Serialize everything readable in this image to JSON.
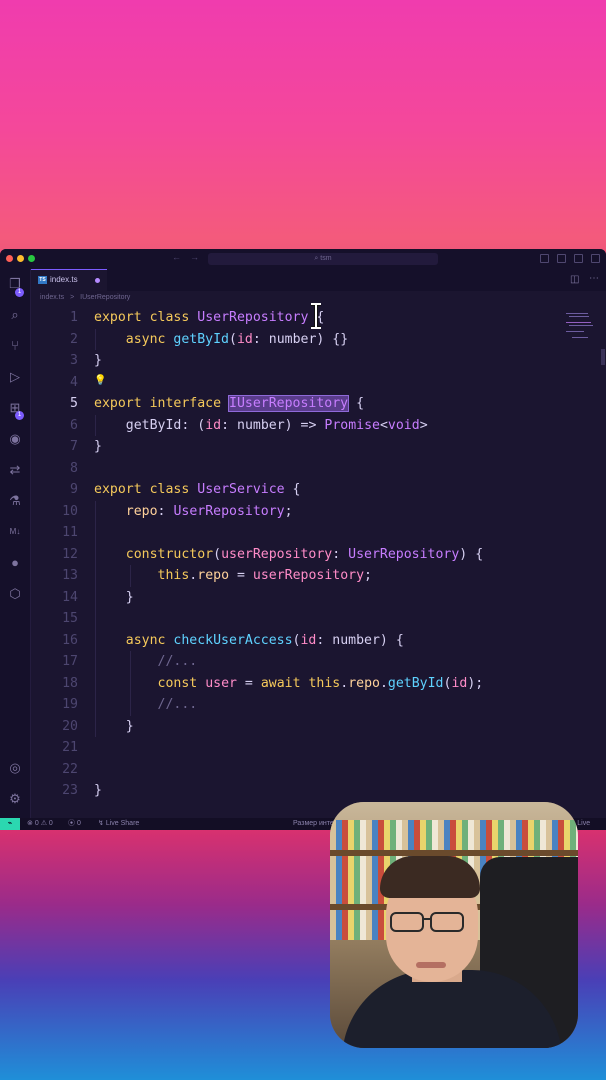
{
  "window": {
    "search_placeholder": "tsm",
    "tab": {
      "name": "index.ts",
      "icon": "typescript-icon"
    },
    "breadcrumb": {
      "file": "index.ts",
      "separator": ">",
      "symbol": "IUserRepository"
    }
  },
  "editor": {
    "active_line": 5,
    "line_numbers": [
      "1",
      "2",
      "3",
      "4",
      "5",
      "6",
      "7",
      "8",
      "9",
      "10",
      "11",
      "12",
      "13",
      "14",
      "15",
      "16",
      "17",
      "18",
      "19",
      "20",
      "21",
      "22",
      "23"
    ],
    "lines": [
      "export class UserRepository {",
      "    async getById(id: number) {}",
      "}",
      "",
      "export interface IUserRepository {",
      "    getById: (id: number) => Promise<void>",
      "}",
      "",
      "export class UserService {",
      "    repo: UserRepository;",
      "",
      "    constructor(userRepository: UserRepository) {",
      "        this.repo = userRepository;",
      "    }",
      "",
      "    async checkUserAccess(id: number) {",
      "        //...",
      "        const user = await this.repo.getById(id);",
      "        //...",
      "    }",
      "",
      "",
      "}"
    ]
  },
  "activity_bar": {
    "items": [
      "files-icon",
      "search-icon",
      "source-control-icon",
      "run-debug-icon",
      "extensions-icon",
      "github-icon",
      "remote-icon",
      "testing-icon",
      "markdown-icon",
      "live-share-icon",
      "extension-pack-icon"
    ],
    "bottom": [
      "account-icon",
      "settings-gear-icon"
    ],
    "badges": {
      "files": "1",
      "extensions": "1"
    }
  },
  "status_bar": {
    "errors": "0",
    "warnings": "0",
    "ports": "0",
    "live_share": "Live Share",
    "right_text": "Размер инте",
    "go_live": "Go Live"
  },
  "colors": {
    "editor_bg": "#1b1530",
    "keyword": "#f5c95b",
    "class": "#c77dff",
    "function": "#5fd2ff",
    "parameter": "#ff8cc8",
    "remote_indicator": "#2bd7b0"
  }
}
